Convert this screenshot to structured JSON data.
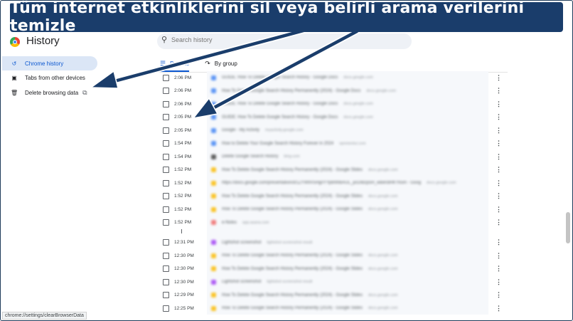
{
  "banner": {
    "text": "Tüm internet etkinliklerini sil veya belirli arama verilerini temizle"
  },
  "app": {
    "title": "History"
  },
  "search": {
    "placeholder": "Search history"
  },
  "sidebar": {
    "items": [
      {
        "label": "Chrome history",
        "icon": "history-icon"
      },
      {
        "label": "Tabs from other devices",
        "icon": "devices-icon"
      },
      {
        "label": "Delete browsing data",
        "icon": "trash-icon"
      }
    ]
  },
  "tabs": [
    {
      "label": "By date",
      "icon": "list-icon"
    },
    {
      "label": "By group",
      "icon": "group-icon"
    }
  ],
  "entries": [
    {
      "time": "2:06 PM",
      "title": "GUIDE: How To Delete Google Search History - Google Docs",
      "domain": "docs.google.com",
      "fav": "#4285f4"
    },
    {
      "time": "2:06 PM",
      "title": "How To Delete Google Search History Permanently (2024) - Google Docs",
      "domain": "docs.google.com",
      "fav": "#4285f4"
    },
    {
      "time": "2:06 PM",
      "title": "GUIDE: How To Delete Google Search History - Google Docs",
      "domain": "docs.google.com",
      "fav": "#4285f4"
    },
    {
      "time": "2:05 PM",
      "title": "GUIDE: How To Delete Google Search History - Google Docs",
      "domain": "docs.google.com",
      "fav": "#4285f4"
    },
    {
      "time": "2:05 PM",
      "title": "Google - My Activity",
      "domain": "myactivity.google.com",
      "fav": "#4285f4"
    },
    {
      "time": "1:54 PM",
      "title": "How to Delete Your Google Search History Forever in 2024",
      "domain": "vpnmentor.com",
      "fav": "#4285f4"
    },
    {
      "time": "1:54 PM",
      "title": "Delete Google Search History",
      "domain": "bing.com",
      "fav": "#444444"
    },
    {
      "time": "1:52 PM",
      "title": "How To Delete Google Search History Permanently (2024) - Google Slides",
      "domain": "docs.google.com",
      "fav": "#fbbc05"
    },
    {
      "time": "1:52 PM",
      "title": "https://docs.google.com/presentation/d/1ZYW9V5Hg0YYpbNNbAUL_pcDIBzp5H_wBe0dHKYk5m - Goog",
      "domain": "docs.google.com",
      "fav": "#fbbc05"
    },
    {
      "time": "1:52 PM",
      "title": "How To Delete Google Search History Permanently (2024) - Google Slides",
      "domain": "docs.google.com",
      "fav": "#fbbc05"
    },
    {
      "time": "1:52 PM",
      "title": "How To Delete Google Search History Permanently (2024) - Google Slides",
      "domain": "docs.google.com",
      "fav": "#fbbc05"
    },
    {
      "time": "1:52 PM",
      "title": "e-Notes",
      "domain": "app.asana.com",
      "fav": "#f06a6a"
    },
    {
      "time": "12:31 PM",
      "title": "Lightshot screenshot",
      "domain": "lightshot screenshot result",
      "fav": "#a142f4"
    },
    {
      "time": "12:30 PM",
      "title": "How To Delete Google Search History Permanently (2024) - Google Slides",
      "domain": "docs.google.com",
      "fav": "#fbbc05"
    },
    {
      "time": "12:30 PM",
      "title": "How To Delete Google Search History Permanently (2024) - Google Slides",
      "domain": "docs.google.com",
      "fav": "#fbbc05"
    },
    {
      "time": "12:30 PM",
      "title": "Lightshot screenshot",
      "domain": "lightshot screenshot result",
      "fav": "#a142f4"
    },
    {
      "time": "12:29 PM",
      "title": "How To Delete Google Search History Permanently (2024) - Google Slides",
      "domain": "docs.google.com",
      "fav": "#fbbc05"
    },
    {
      "time": "12:25 PM",
      "title": "How To Delete Google Search History Permanently (2024) - Google Slides",
      "domain": "docs.google.com",
      "fav": "#fbbc05"
    }
  ],
  "status_url": "chrome://settings/clearBrowserData",
  "colors": {
    "banner": "#1a3d6b",
    "accent": "#0b57d0",
    "active_bg": "#dbe6f6"
  }
}
